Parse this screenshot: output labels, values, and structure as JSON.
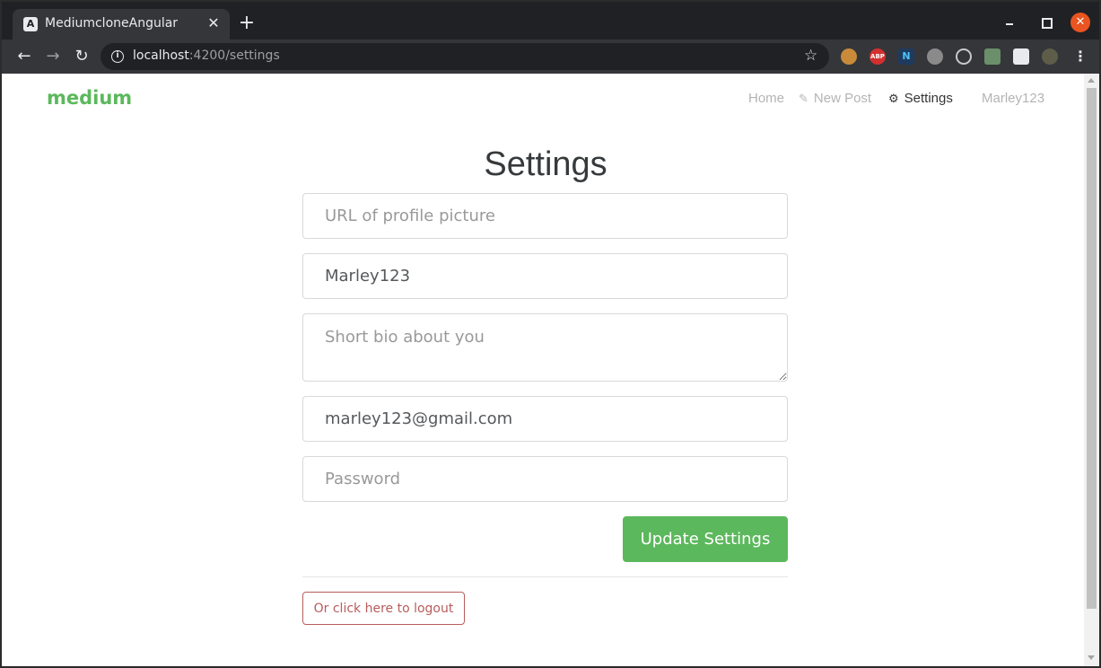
{
  "browser": {
    "tab_title": "MediumcloneAngular",
    "tab_favicon": "A",
    "url_host": "localhost",
    "url_path": ":4200/settings",
    "icons": [
      "back-icon",
      "forward-icon",
      "reload-icon",
      "info-icon",
      "star-icon",
      "cookie-extension-icon",
      "adblock-extension-icon",
      "ngrx-extension-icon",
      "cloud-extension-icon",
      "react-extension-icon",
      "redux-extension-icon",
      "puzzle-extension-icon",
      "profile-avatar-icon",
      "kebab-menu-icon"
    ],
    "abp_label": "ABP",
    "ngrx_label": "N"
  },
  "navbar": {
    "brand": "medium",
    "home": "Home",
    "new_post": "New Post",
    "settings": "Settings",
    "username": "Marley123"
  },
  "settings": {
    "title": "Settings",
    "image_placeholder": "URL of profile picture",
    "username_value": "Marley123",
    "bio_placeholder": "Short bio about you",
    "email_value": "marley123@gmail.com",
    "password_placeholder": "Password",
    "update_button": "Update Settings",
    "logout_button": "Or click here to logout"
  },
  "colors": {
    "brand_green": "#5cb85c",
    "danger": "#b85c5c",
    "chrome_dark": "#202124",
    "chrome_toolbar": "#35363a"
  }
}
